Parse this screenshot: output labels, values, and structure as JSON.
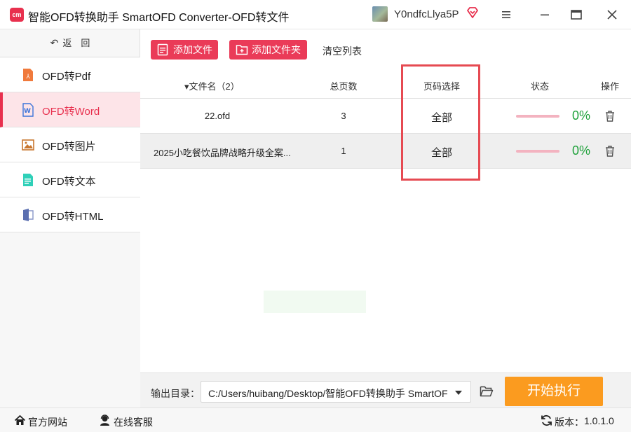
{
  "app": {
    "logo_text": "cm",
    "title": "智能OFD转换助手 SmartOFD Converter-OFD转文件",
    "username": "Y0ndfcLlya5P"
  },
  "sidebar": {
    "back_label": "返　回",
    "items": [
      {
        "label": "OFD转Pdf",
        "icon": "pdf-icon",
        "active": false
      },
      {
        "label": "OFD转Word",
        "icon": "word-icon",
        "active": true
      },
      {
        "label": "OFD转图片",
        "icon": "image-icon",
        "active": false
      },
      {
        "label": "OFD转文本",
        "icon": "text-file-icon",
        "active": false
      },
      {
        "label": "OFD转HTML",
        "icon": "html-file-icon",
        "active": false
      }
    ]
  },
  "toolbar": {
    "add_file": "添加文件",
    "add_folder": "添加文件夹",
    "clear_list": "清空列表"
  },
  "table": {
    "headers": {
      "name": "▾文件名（2）",
      "pages": "总页数",
      "range": "页码选择",
      "status": "状态",
      "action": "操作"
    },
    "rows": [
      {
        "name": "22.ofd",
        "pages": "3",
        "range": "全部",
        "progress": 0,
        "percent": "0%"
      },
      {
        "name": "2025小吃餐饮品牌战略升级全案...",
        "pages": "1",
        "range": "全部",
        "progress": 0,
        "percent": "0%"
      }
    ]
  },
  "output": {
    "label": "输出目录：",
    "path": "C:/Users/huibang/Desktop/智能OFD转换助手 SmartOFD",
    "start_button": "开始执行"
  },
  "statusbar": {
    "website": "官方网站",
    "support": "在线客服",
    "version_label": "版本：",
    "version": "1.0.1.0"
  },
  "colors": {
    "accent": "#e8304e",
    "start_button": "#fb9b1f",
    "percent": "#1ea13a",
    "highlight_box": "#e64a52"
  }
}
